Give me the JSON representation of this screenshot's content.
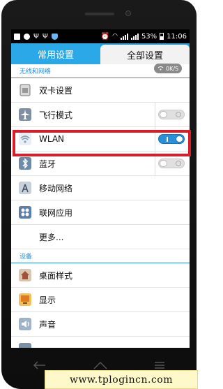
{
  "status_bar": {
    "battery_percent": "53%",
    "time": "11:06"
  },
  "tabs": [
    {
      "label": "常用设置",
      "active": true
    },
    {
      "label": "全部设置",
      "active": false
    }
  ],
  "speed_badge": "0K/S",
  "sections": {
    "wireless": "无线和网络",
    "device": "设备"
  },
  "rows": {
    "dual_sim": {
      "label": "双卡设置",
      "icon": "sim-card-icon"
    },
    "airplane": {
      "label": "飞行模式",
      "icon": "airplane-icon",
      "toggle": "off"
    },
    "wlan": {
      "label": "WLAN",
      "icon": "wifi-icon",
      "toggle": "on"
    },
    "bluetooth": {
      "label": "蓝牙",
      "icon": "bluetooth-icon",
      "toggle": "off"
    },
    "mobile_network": {
      "label": "移动网络",
      "icon": "antenna-icon"
    },
    "network_apps": {
      "label": "联网应用",
      "icon": "network-apps-icon"
    },
    "more": {
      "label": "更多..."
    },
    "desktop_style": {
      "label": "桌面样式",
      "icon": "home-icon"
    },
    "display": {
      "label": "显示",
      "icon": "display-icon"
    },
    "sound": {
      "label": "声音",
      "icon": "speaker-icon"
    }
  },
  "watermark": "www.tplogincn.com",
  "colors": {
    "accent": "#2aa8e8",
    "section": "#2a8fd0",
    "highlight": "#d81e2a",
    "toggle_on": "#2a8fd6"
  }
}
